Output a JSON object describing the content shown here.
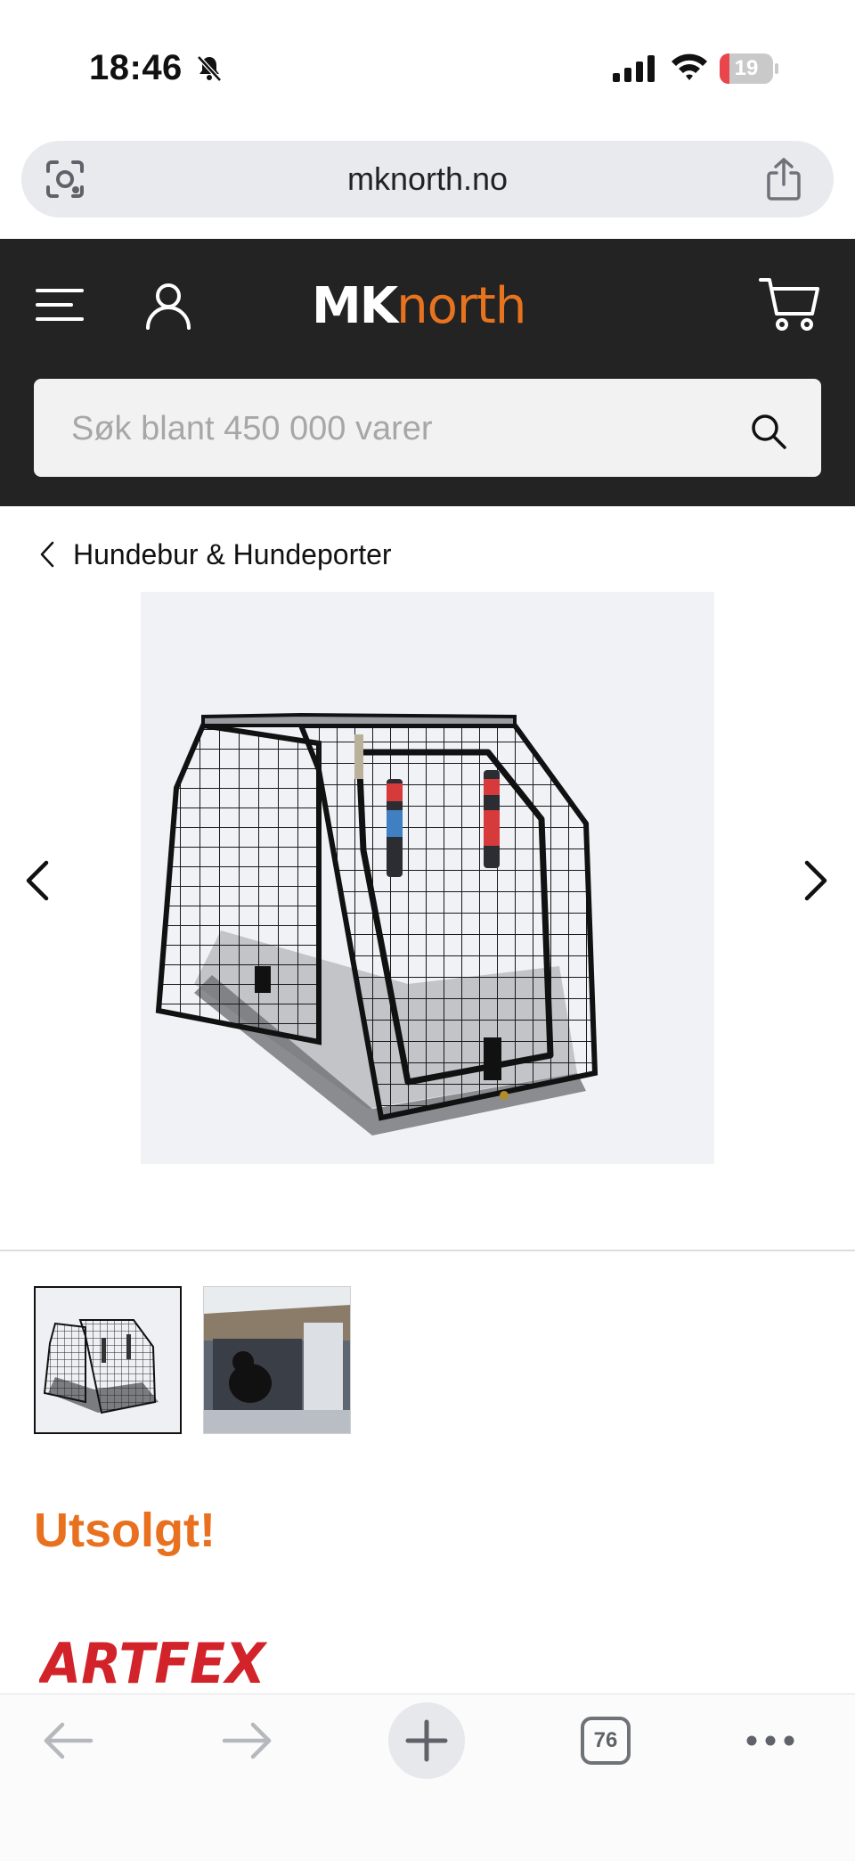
{
  "status_bar": {
    "time": "18:46",
    "battery_level": "19",
    "battery_fraction": 0.19
  },
  "browser": {
    "url": "mknorth.no",
    "tab_count": "76"
  },
  "header": {
    "logo_part1": "MK",
    "logo_part2": "north",
    "brand_color": "#e8731e",
    "background_color": "#232323",
    "search_placeholder": "Søk blant 450 000 varer"
  },
  "breadcrumb": {
    "label": "Hundebur & Hundeporter"
  },
  "product": {
    "status": "Utsolgt!",
    "status_color": "#e8701e",
    "brand": "ARTFEX"
  },
  "icons": {
    "menu": "hamburger-menu-icon",
    "user": "user-icon",
    "cart": "cart-icon",
    "search": "search-icon",
    "share": "share-icon",
    "page-tools": "page-tools-icon",
    "silent": "bell-slash-icon"
  }
}
